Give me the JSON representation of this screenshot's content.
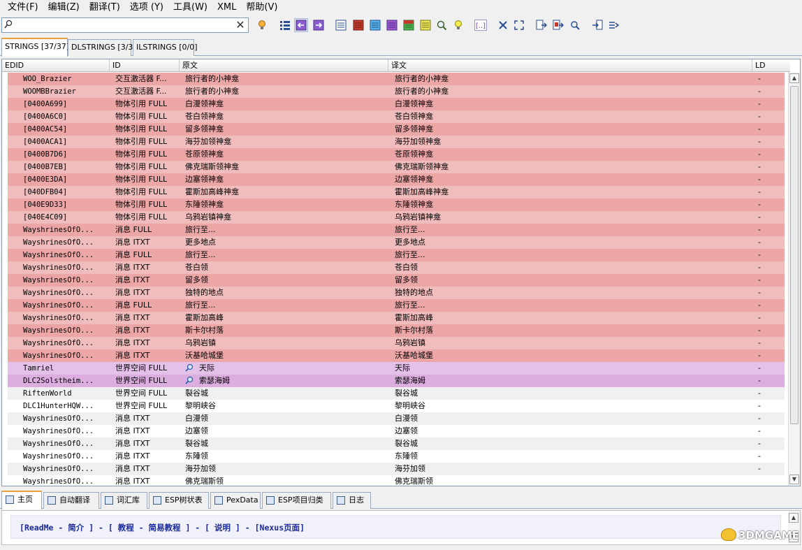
{
  "menu": [
    "文件(F)",
    "编辑(Z)",
    "翻译(T)",
    "选项 (Y)",
    "工具(W)",
    "XML",
    "帮助(V)"
  ],
  "search": {
    "value": "",
    "placeholder": ""
  },
  "tabs": [
    "STRINGS [37/37]",
    "DLSTRINGS [3/3]",
    "ILSTRINGS [0/0]"
  ],
  "columns": [
    "EDID",
    "ID",
    "原文",
    "译文",
    "LD"
  ],
  "rows": [
    {
      "edid": "WOO_Brazier",
      "id": "交互激活器 F...",
      "src": "旅行者的小神龛",
      "dst": "旅行者的小神龛",
      "ld": "-",
      "status": "red"
    },
    {
      "edid": "WOOMBBrazier",
      "id": "交互激活器 F...",
      "src": "旅行者的小神龛",
      "dst": "旅行者的小神龛",
      "ld": "-",
      "status": "red"
    },
    {
      "edid": "[0400A699]",
      "id": "物体引用 FULL",
      "src": "白漫领神龛",
      "dst": "白漫领神龛",
      "ld": "-",
      "status": "red"
    },
    {
      "edid": "[0400A6C0]",
      "id": "物体引用 FULL",
      "src": "苍白领神龛",
      "dst": "苍白领神龛",
      "ld": "-",
      "status": "red"
    },
    {
      "edid": "[0400AC54]",
      "id": "物体引用 FULL",
      "src": "留多领神龛",
      "dst": "留多领神龛",
      "ld": "-",
      "status": "red"
    },
    {
      "edid": "[0400ACA1]",
      "id": "物体引用 FULL",
      "src": "海芬加领神龛",
      "dst": "海芬加领神龛",
      "ld": "-",
      "status": "red"
    },
    {
      "edid": "[0400B7D6]",
      "id": "物体引用 FULL",
      "src": "苍原领神龛",
      "dst": "苍原领神龛",
      "ld": "-",
      "status": "red"
    },
    {
      "edid": "[0400B7EB]",
      "id": "物体引用 FULL",
      "src": "佛克瑞斯领神龛",
      "dst": "佛克瑞斯领神龛",
      "ld": "-",
      "status": "red"
    },
    {
      "edid": "[0400E3DA]",
      "id": "物体引用 FULL",
      "src": "边塞领神龛",
      "dst": "边塞领神龛",
      "ld": "-",
      "status": "red"
    },
    {
      "edid": "[040DFB04]",
      "id": "物体引用 FULL",
      "src": "霍斯加高峰神龛",
      "dst": "霍斯加高峰神龛",
      "ld": "-",
      "status": "red"
    },
    {
      "edid": "[040E9D33]",
      "id": "物体引用 FULL",
      "src": "东陲领神龛",
      "dst": "东陲领神龛",
      "ld": "-",
      "status": "red"
    },
    {
      "edid": "[040E4C09]",
      "id": "物体引用 FULL",
      "src": "乌鸦岩镇神龛",
      "dst": "乌鸦岩镇神龛",
      "ld": "-",
      "status": "red"
    },
    {
      "edid": "WayshrinesOfO...",
      "id": "消息 FULL",
      "src": "旅行至...",
      "dst": "旅行至...",
      "ld": "-",
      "status": "red"
    },
    {
      "edid": "WayshrinesOfO...",
      "id": "消息 ITXT",
      "src": "更多地点",
      "dst": "更多地点",
      "ld": "-",
      "status": "red"
    },
    {
      "edid": "WayshrinesOfO...",
      "id": "消息 FULL",
      "src": "旅行至...",
      "dst": "旅行至...",
      "ld": "-",
      "status": "red"
    },
    {
      "edid": "WayshrinesOfO...",
      "id": "消息 ITXT",
      "src": "苍白领",
      "dst": "苍白领",
      "ld": "-",
      "status": "red"
    },
    {
      "edid": "WayshrinesOfO...",
      "id": "消息 ITXT",
      "src": "留多领",
      "dst": "留多领",
      "ld": "-",
      "status": "red"
    },
    {
      "edid": "WayshrinesOfO...",
      "id": "消息 ITXT",
      "src": "独特的地点",
      "dst": "独特的地点",
      "ld": "-",
      "status": "red"
    },
    {
      "edid": "WayshrinesOfO...",
      "id": "消息 FULL",
      "src": "旅行至...",
      "dst": "旅行至...",
      "ld": "-",
      "status": "red"
    },
    {
      "edid": "WayshrinesOfO...",
      "id": "消息 ITXT",
      "src": "霍斯加高峰",
      "dst": "霍斯加高峰",
      "ld": "-",
      "status": "red"
    },
    {
      "edid": "WayshrinesOfO...",
      "id": "消息 ITXT",
      "src": "斯卡尔村落",
      "dst": "斯卡尔村落",
      "ld": "-",
      "status": "red"
    },
    {
      "edid": "WayshrinesOfO...",
      "id": "消息 ITXT",
      "src": "乌鸦岩镇",
      "dst": "乌鸦岩镇",
      "ld": "-",
      "status": "red"
    },
    {
      "edid": "WayshrinesOfO...",
      "id": "消息 ITXT",
      "src": "沃基哈城堡",
      "dst": "沃基哈城堡",
      "ld": "-",
      "status": "red"
    },
    {
      "edid": "Tamriel",
      "id": "世界空间 FULL",
      "src": "天际",
      "dst": "天际",
      "ld": "-",
      "status": "purple",
      "icon": true
    },
    {
      "edid": "DLC2Solstheim...",
      "id": "世界空间 FULL",
      "src": "索瑟海姆",
      "dst": "索瑟海姆",
      "ld": "-",
      "status": "purple",
      "icon": true
    },
    {
      "edid": "RiftenWorld",
      "id": "世界空间 FULL",
      "src": "裂谷城",
      "dst": "裂谷城",
      "ld": "-",
      "status": "white"
    },
    {
      "edid": "DLC1HunterHQW...",
      "id": "世界空间 FULL",
      "src": "黎明峡谷",
      "dst": "黎明峡谷",
      "ld": "-",
      "status": "white"
    },
    {
      "edid": "WayshrinesOfO...",
      "id": "消息 ITXT",
      "src": "白漫领",
      "dst": "白漫领",
      "ld": "-",
      "status": "white"
    },
    {
      "edid": "WayshrinesOfO...",
      "id": "消息 ITXT",
      "src": "边塞领",
      "dst": "边塞领",
      "ld": "-",
      "status": "white"
    },
    {
      "edid": "WayshrinesOfO...",
      "id": "消息 ITXT",
      "src": "裂谷城",
      "dst": "裂谷城",
      "ld": "-",
      "status": "white"
    },
    {
      "edid": "WayshrinesOfO...",
      "id": "消息 ITXT",
      "src": "东陲领",
      "dst": "东陲领",
      "ld": "-",
      "status": "white"
    },
    {
      "edid": "WayshrinesOfO...",
      "id": "消息 ITXT",
      "src": "海芬加领",
      "dst": "海芬加领",
      "ld": "-",
      "status": "white"
    },
    {
      "edid": "WayshrinesOfO...",
      "id": "消息 ITXT",
      "src": "佛克瑞斯领",
      "dst": "佛克瑞斯领",
      "ld": "",
      "status": "white"
    }
  ],
  "row_colors": {
    "red_a": "#eda6a6",
    "red_b": "#f0bcbc",
    "purple_a": "#dcaee0",
    "purple_b": "#e3c1e8",
    "white_a": "#ffffff",
    "white_b": "#f0f0f0"
  },
  "bottom_tabs": [
    "主页",
    "自动翻译",
    "词汇库",
    "ESP树状表",
    "PexData",
    "ESP项目归类",
    "日志"
  ],
  "links": {
    "readme": "ReadMe",
    "intro": "简介",
    "tutorial": "教程",
    "quick_tutorial": "简易教程",
    "help": "说明",
    "nexus": "Nexus页面"
  },
  "watermark": "3DMGAME"
}
